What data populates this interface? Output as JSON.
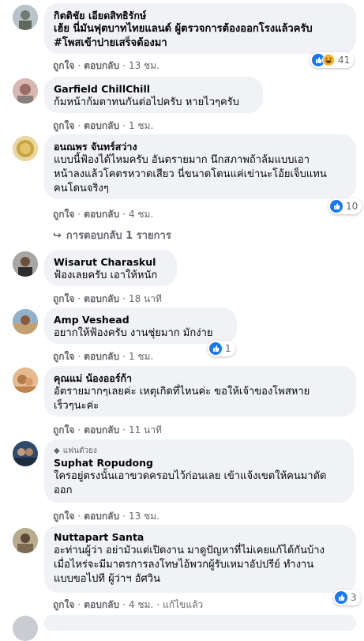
{
  "actions": {
    "like": "ถูกใจ",
    "reply": "ตอบกลับ",
    "sep": "·"
  },
  "comments": [
    {
      "name": "กิตติชัย เอียดสิทธิรักษ์",
      "lines": [
        "เฮ้ย นี่มันฟุตบาทไทยแลนด์ ผู้ตรวจการต้องออกโรงแล้วครับ",
        "#โพสเข้าบ่ายเสร็จต้องมา"
      ],
      "time": "13 ชม.",
      "reaction_icons": [
        "like-icon",
        "haha-icon"
      ],
      "reaction_count": "41"
    },
    {
      "name": "Garfield ChillChill",
      "lines": [
        "ก้มหน้าก้มตาทนกันต่อไปครับ หายไวๆครับ"
      ],
      "time": "1 ชม."
    },
    {
      "name": "อนณพร จันทร์สว่าง",
      "lines": [
        "แบบนี้ฟ้องได้ไหมครับ อันตรายมาก นึกสภาพถ้าล้มแบบเอา",
        "หน้าลงแล้วโคตรหวาดเสียว นี่ขนาดโดนแค่เข่านะโอ้ยเจ็บแทน",
        "คนโดนจริงๆ"
      ],
      "time": "4 ชม.",
      "reaction_icons": [
        "like-icon"
      ],
      "reaction_count": "10",
      "replies": "การตอบกลับ 1 รายการ"
    },
    {
      "name": "Wisarut Charaskul",
      "lines": [
        "ฟ้องเลยครับ เอาให้หนัก"
      ],
      "time": "18 นาที"
    },
    {
      "name": "Amp Veshead",
      "lines": [
        "อยากให้ฟ้องครับ งานชุ่ยมาก มักง่าย"
      ],
      "time": "1 ชม.",
      "reaction_icons": [
        "like-icon"
      ],
      "reaction_count": "1"
    },
    {
      "name": "คุณแม่ น้องออร์ก้า",
      "lines": [
        "อัตรายมากๆเลยค่ะ เหตุเกิดที่ไหนค่ะ ขอให้เจ้าของโพสหาย",
        "เร็วๆนะค่ะ"
      ],
      "time": "11 นาที"
    },
    {
      "badge": "แฟนตัวยง",
      "name": "Suphat Ropudong",
      "lines": [
        "ใครอยู่ตรงนั้นเอาขวดครอบไว้ก่อนเลย เข้าแจ้งเขตให้คนมาตัด",
        "ออก"
      ],
      "time": "13 ชม."
    },
    {
      "name": "Nuttapart Santa",
      "lines": [
        "อะท่านผู้ว่า อย่ามัวแต่เปิดงาน มาดูปัญหาที่ไม่เคยแก้ได้กันบ้าง",
        "เมื่อไหร่จะมีมาตรการลงโทษไอ้พวกผู้รับเหมาอัปปรีย์ ทำงาน",
        "แบบขอไปที ผู้ว่าฯ อัศวิน"
      ],
      "time": "4 ชม.",
      "edited": "แก้ไขแล้ว",
      "reaction_icons": [
        "like-icon"
      ],
      "reaction_count": "3"
    }
  ]
}
